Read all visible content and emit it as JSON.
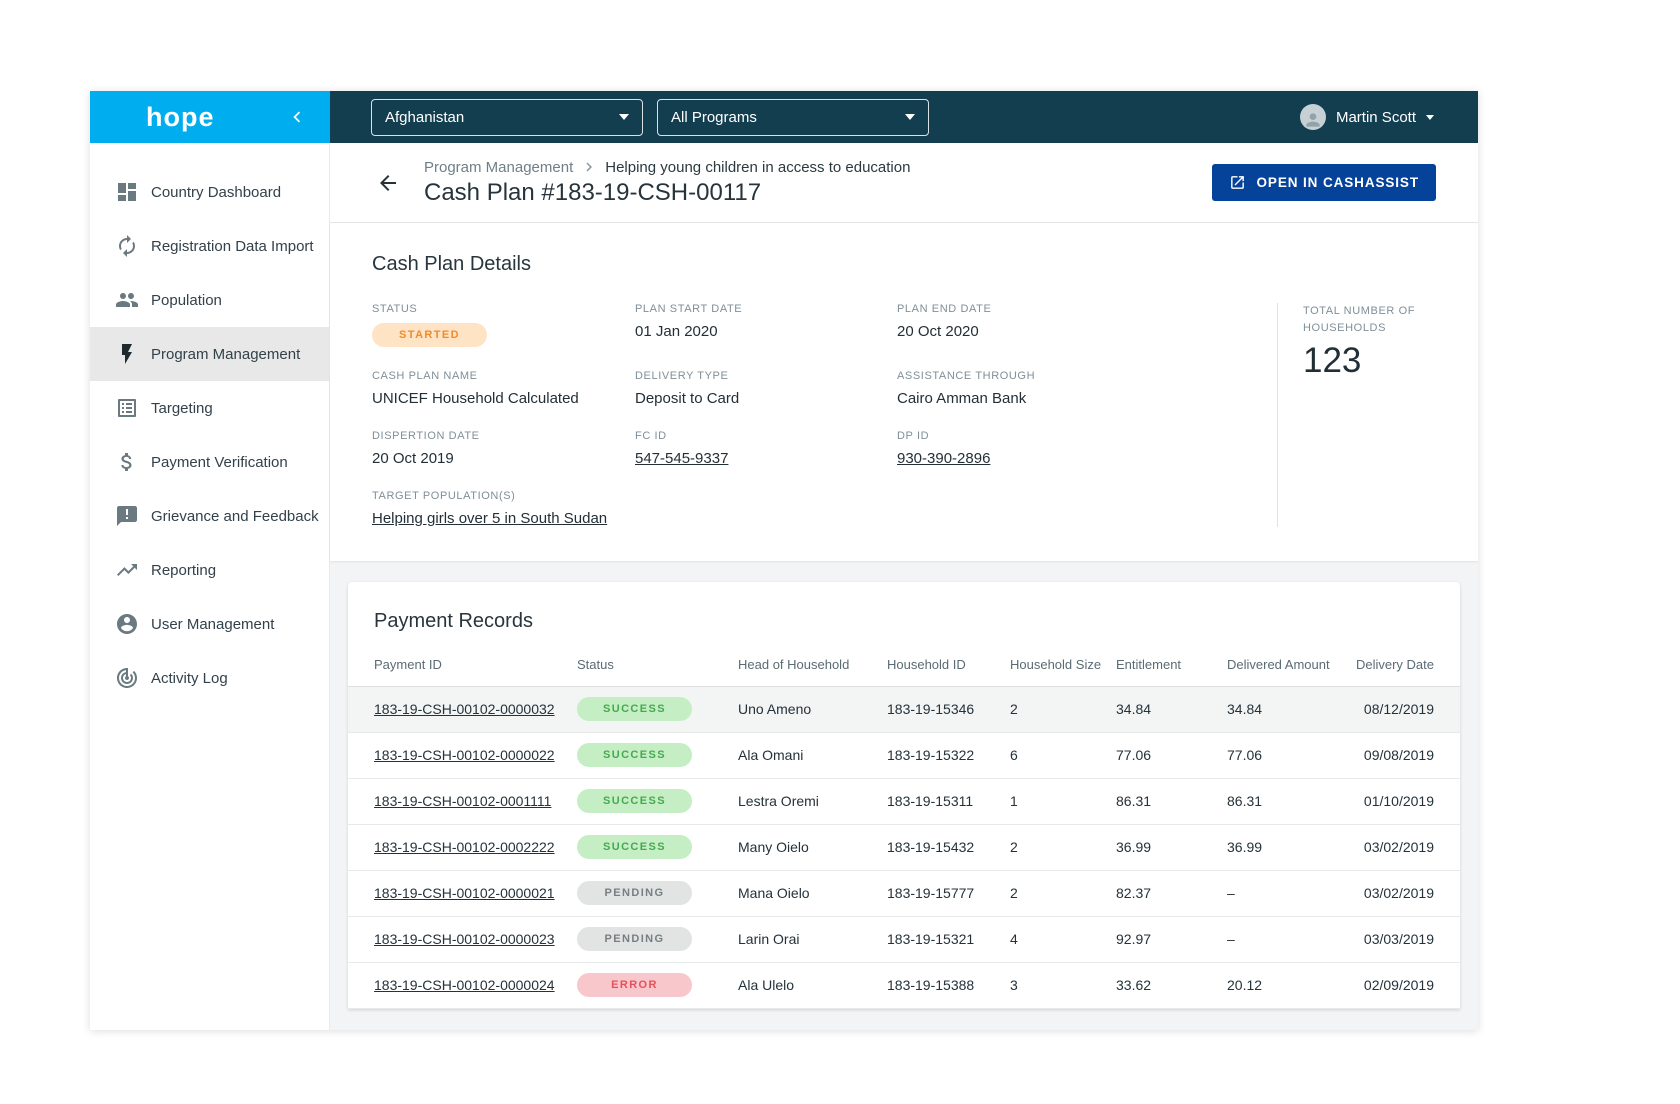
{
  "colors": {
    "brand_blue": "#00ADEF",
    "topbar": "#123E4F",
    "primary_button": "#05439B",
    "status_started_bg": "#FFE3C5",
    "status_started_text": "#EE8D2E",
    "status_success_bg": "#C5EEC5",
    "status_success_text": "#47A94F",
    "status_pending_bg": "#E2E3E3",
    "status_pending_text": "#767F83",
    "status_error_bg": "#F8C7CB",
    "status_error_text": "#E4515B"
  },
  "logo": {
    "text": "hope"
  },
  "topbar": {
    "location_select": "Afghanistan",
    "program_select": "All Programs",
    "user_name": "Martin Scott"
  },
  "sidebar": {
    "items": [
      {
        "label": "Country Dashboard",
        "icon": "dashboard-icon"
      },
      {
        "label": "Registration Data Import",
        "icon": "sync-icon"
      },
      {
        "label": "Population",
        "icon": "people-icon"
      },
      {
        "label": "Program Management",
        "icon": "bolt-icon"
      },
      {
        "label": "Targeting",
        "icon": "list-icon"
      },
      {
        "label": "Payment Verification",
        "icon": "dollar-icon"
      },
      {
        "label": "Grievance and Feedback",
        "icon": "feedback-icon"
      },
      {
        "label": "Reporting",
        "icon": "trending-up-icon"
      },
      {
        "label": "User Management",
        "icon": "user-circle-icon"
      },
      {
        "label": "Activity Log",
        "icon": "activity-icon"
      }
    ]
  },
  "header": {
    "breadcrumb_section": "Program Management",
    "breadcrumb_page": "Helping young children in access to education",
    "title": "Cash Plan #183-19-CSH-00117",
    "open_button": "OPEN IN CASHASSIST"
  },
  "details": {
    "title": "Cash Plan Details",
    "fields": [
      {
        "label": "STATUS",
        "value": "STARTED"
      },
      {
        "label": "PLAN START DATE",
        "value": "01 Jan 2020"
      },
      {
        "label": "PLAN END DATE",
        "value": "20 Oct 2020"
      },
      {
        "label": "CASH PLAN NAME",
        "value": "UNICEF Household Calculated"
      },
      {
        "label": "DELIVERY TYPE",
        "value": "Deposit to Card"
      },
      {
        "label": "ASSISTANCE THROUGH",
        "value": "Cairo Amman Bank"
      },
      {
        "label": "DISPERTION DATE",
        "value": "20 Oct 2019"
      },
      {
        "label": "FC ID",
        "value": "547-545-9337"
      },
      {
        "label": "DP ID",
        "value": "930-390-2896"
      },
      {
        "label": "TARGET POPULATION(S)",
        "value": "Helping girls over 5 in South Sudan"
      }
    ],
    "households": {
      "label": "TOTAL NUMBER OF HOUSEHOLDS",
      "value": "123"
    }
  },
  "payments": {
    "title": "Payment Records",
    "columns": [
      "Payment ID",
      "Status",
      "Head of Household",
      "Household ID",
      "Household Size",
      "Entitlement",
      "Delivered Amount",
      "Delivery Date"
    ],
    "rows": [
      {
        "id": "183-19-CSH-00102-0000032",
        "status": "SUCCESS",
        "head": "Uno Ameno",
        "household_id": "183-19-15346",
        "size": "2",
        "entitlement": "34.84",
        "delivered": "34.84",
        "date": "08/12/2019"
      },
      {
        "id": "183-19-CSH-00102-0000022",
        "status": "SUCCESS",
        "head": "Ala Omani",
        "household_id": "183-19-15322",
        "size": "6",
        "entitlement": "77.06",
        "delivered": "77.06",
        "date": "09/08/2019"
      },
      {
        "id": "183-19-CSH-00102-0001111",
        "status": "SUCCESS",
        "head": "Lestra Oremi",
        "household_id": "183-19-15311",
        "size": "1",
        "entitlement": "86.31",
        "delivered": "86.31",
        "date": "01/10/2019"
      },
      {
        "id": "183-19-CSH-00102-0002222",
        "status": "SUCCESS",
        "head": "Many Oielo",
        "household_id": "183-19-15432",
        "size": "2",
        "entitlement": "36.99",
        "delivered": "36.99",
        "date": "03/02/2019"
      },
      {
        "id": "183-19-CSH-00102-0000021",
        "status": "PENDING",
        "head": "Mana Oielo",
        "household_id": "183-19-15777",
        "size": "2",
        "entitlement": "82.37",
        "delivered": "–",
        "date": "03/02/2019"
      },
      {
        "id": "183-19-CSH-00102-0000023",
        "status": "PENDING",
        "head": "Larin Orai",
        "household_id": "183-19-15321",
        "size": "4",
        "entitlement": "92.97",
        "delivered": "–",
        "date": "03/03/2019"
      },
      {
        "id": "183-19-CSH-00102-0000024",
        "status": "ERROR",
        "head": "Ala Ulelo",
        "household_id": "183-19-15388",
        "size": "3",
        "entitlement": "33.62",
        "delivered": "20.12",
        "date": "02/09/2019"
      }
    ]
  }
}
